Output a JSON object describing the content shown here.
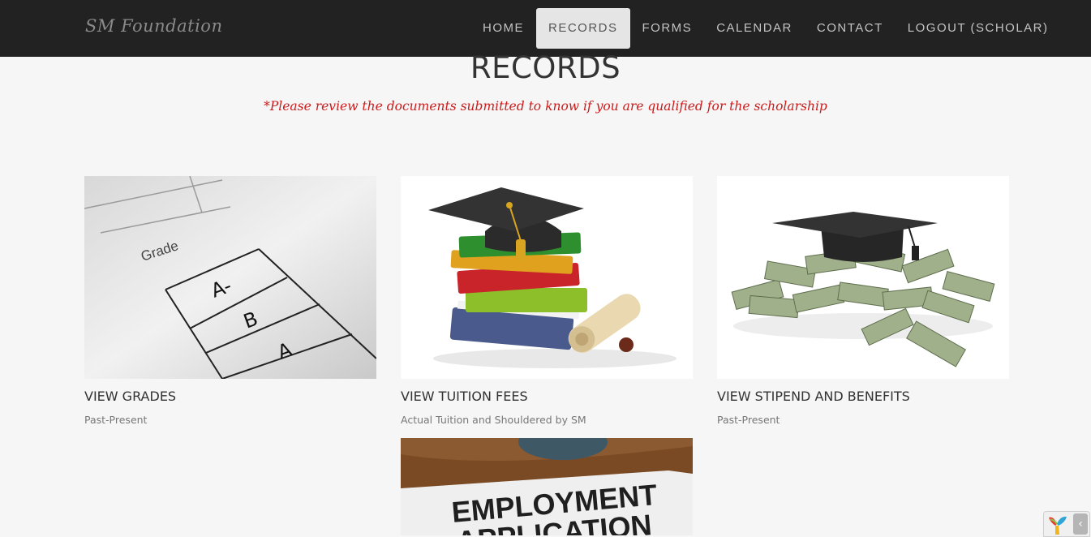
{
  "brand": "SM Foundation",
  "nav": [
    {
      "label": "HOME",
      "active": false
    },
    {
      "label": "RECORDS",
      "active": true
    },
    {
      "label": "FORMS",
      "active": false
    },
    {
      "label": "CALENDAR",
      "active": false
    },
    {
      "label": "CONTACT",
      "active": false
    },
    {
      "label": "LOGOUT (SCHOLAR)",
      "active": false
    }
  ],
  "page": {
    "title": "RECORDS",
    "notice": "*Please review the documents submitted to know if you are qualified for the scholarship"
  },
  "cards": [
    {
      "title": "VIEW GRADES",
      "subtitle": "Past-Present",
      "image": "grades-sheet-photo"
    },
    {
      "title": "VIEW TUITION FEES",
      "subtitle": "Actual Tuition and Shouldered by SM",
      "image": "books-graduation-cap-photo"
    },
    {
      "title": "VIEW STIPEND AND BENEFITS",
      "subtitle": "Past-Present",
      "image": "money-graduation-cap-photo"
    },
    {
      "title": "",
      "subtitle": "",
      "image": "employment-application-photo"
    }
  ],
  "grades_photo_text": {
    "header": "Grade",
    "values": [
      "A-",
      "B",
      "A"
    ]
  },
  "employment_photo_text": [
    "EMPLOYMENT",
    "APPLICATION"
  ],
  "colors": {
    "navbar": "#222222",
    "active_tab": "#e5e5e5",
    "notice": "#cc1b1b",
    "background": "#f6f6f6"
  },
  "widget": {
    "icon": "yii-logo-icon",
    "toggle_icon": "chevron-left-icon"
  }
}
